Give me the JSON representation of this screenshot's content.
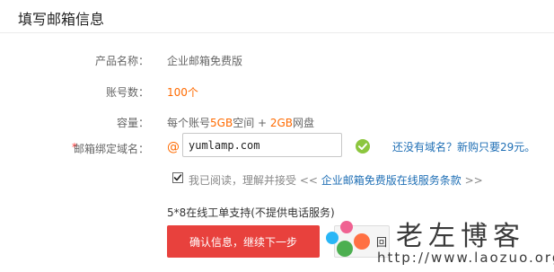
{
  "page_title": "填写邮箱信息",
  "product": {
    "label": "产品名称：",
    "value": "企业邮箱免费版"
  },
  "accounts": {
    "label": "账号数：",
    "value": "100个"
  },
  "capacity": {
    "label": "容量：",
    "text_prefix": "每个账号",
    "mailbox_size": "5GB",
    "text_mid": "空间 + ",
    "disk_size": "2GB",
    "text_suffix": "网盘"
  },
  "domain": {
    "required_mark": "*",
    "label": "邮箱绑定域名：",
    "at": "@",
    "value": "yumlamp.com",
    "no_domain_link": "还没有域名？新购只要29元。"
  },
  "agreement": {
    "checked": true,
    "text": "我已阅读，理解并接受 << ",
    "terms_link": "企业邮箱免费版在线服务条款",
    "suffix": " >>"
  },
  "support_text": "5*8在线工单支持(不提供电话服务)",
  "buttons": {
    "confirm": "确认信息，继续下一步",
    "secondary": "回"
  },
  "watermark": {
    "title": "老左博客",
    "url": "http://www.laozuo.org"
  },
  "colors": {
    "accent": "#ff6a00",
    "link": "#1f6fb5",
    "primary_button": "#e8413d",
    "valid_check": "#8cc63e"
  }
}
